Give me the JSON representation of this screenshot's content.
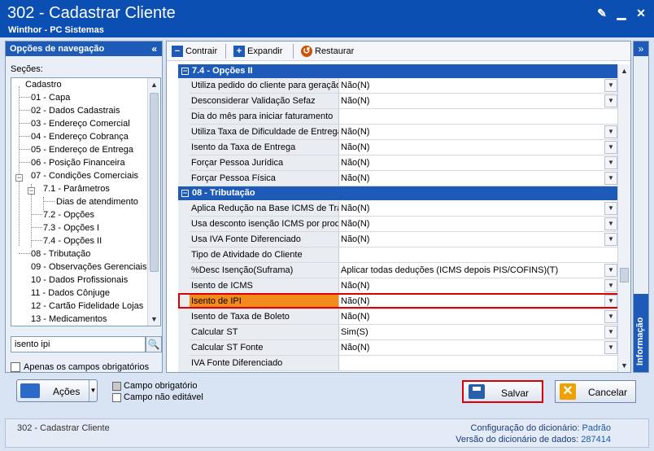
{
  "window": {
    "title": "302 - Cadastrar Cliente",
    "subtitle": "Winthor - PC Sistemas"
  },
  "nav": {
    "header": "Opções de navegação",
    "sections_label": "Seções:",
    "tree": [
      "Cadastro",
      "01 - Capa",
      "02 - Dados Cadastrais",
      "03 - Endereço Comercial",
      "04 - Endereço Cobrança",
      "05 - Endereço de Entrega",
      "06 - Posição Financeira",
      "07 - Condições Comerciais",
      "7.1 - Parâmetros",
      "Dias de atendimento",
      "7.2 - Opções",
      "7.3 - Opções I",
      "7.4 - Opções II",
      "08 - Tributação",
      "09 - Observações Gerenciais",
      "10 - Dados Profissionais",
      "11 - Dados Cônjuge",
      "12 - Cartão Fidelidade Lojas",
      "13 - Medicamentos"
    ],
    "search_value": "isento ipi",
    "only_required_label": "Apenas os campos obrigatórios"
  },
  "toolbar": {
    "contrair": "Contrair",
    "expandir": "Expandir",
    "restaurar": "Restaurar"
  },
  "sections": [
    {
      "title": "7.4 - Opções II",
      "rows": [
        {
          "label": "Utiliza pedido do cliente para geração",
          "value": "Não(N)",
          "dropdown": true
        },
        {
          "label": "Desconsiderar Validação Sefaz",
          "value": "Não(N)",
          "dropdown": true
        },
        {
          "label": "Dia do mês para iniciar faturamento",
          "value": "",
          "dropdown": false
        },
        {
          "label": "Utiliza Taxa de Dificuldade de Entrega",
          "value": "Não(N)",
          "dropdown": true
        },
        {
          "label": "Isento da Taxa de Entrega",
          "value": "Não(N)",
          "dropdown": true
        },
        {
          "label": "Forçar Pessoa Jurídica",
          "value": "Não(N)",
          "dropdown": true
        },
        {
          "label": "Forçar Pessoa Física",
          "value": "Não(N)",
          "dropdown": true
        }
      ]
    },
    {
      "title": "08 - Tributação",
      "rows": [
        {
          "label": "Aplica Redução na Base ICMS de Transf",
          "value": "Não(N)",
          "dropdown": true
        },
        {
          "label": "Usa desconto isenção ICMS por produto",
          "value": "Não(N)",
          "dropdown": true
        },
        {
          "label": "Usa IVA Fonte Diferenciado",
          "value": "Não(N)",
          "dropdown": true
        },
        {
          "label": "Tipo de Atividade do Cliente",
          "value": "",
          "dropdown": false
        },
        {
          "label": "%Desc Isenção(Suframa)",
          "value": "Aplicar todas deduções (ICMS depois PIS/COFINS)(T)",
          "dropdown": true
        },
        {
          "label": "Isento de ICMS",
          "value": "Não(N)",
          "dropdown": true
        },
        {
          "label": "Isento de IPI",
          "value": "Não(N)",
          "dropdown": true,
          "highlight": true
        },
        {
          "label": "Isento de Taxa de Boleto",
          "value": "Não(N)",
          "dropdown": true
        },
        {
          "label": "Calcular ST",
          "value": "Sim(S)",
          "dropdown": true
        },
        {
          "label": "Calcular ST Fonte",
          "value": "Não(N)",
          "dropdown": true
        },
        {
          "label": "IVA Fonte Diferenciado",
          "value": "",
          "dropdown": false
        }
      ]
    }
  ],
  "info_panel_label": "Informação",
  "bottom": {
    "acoes": "Ações",
    "legend_required": "Campo obrigatório",
    "legend_not_editable": "Campo não editável",
    "salvar": "Salvar",
    "cancelar": "Cancelar"
  },
  "status": {
    "left": "302 - Cadastrar Cliente",
    "config_label": "Configuração do dicionário:",
    "config_value": "Padrão",
    "version_label": "Versão do dicionário de dados:",
    "version_value": "287414"
  },
  "colors": {
    "titlebar": "#0b4fb3",
    "section_header": "#1e5bb8",
    "highlight_label": "#f28a1c",
    "highlight_border": "#dd0000"
  }
}
